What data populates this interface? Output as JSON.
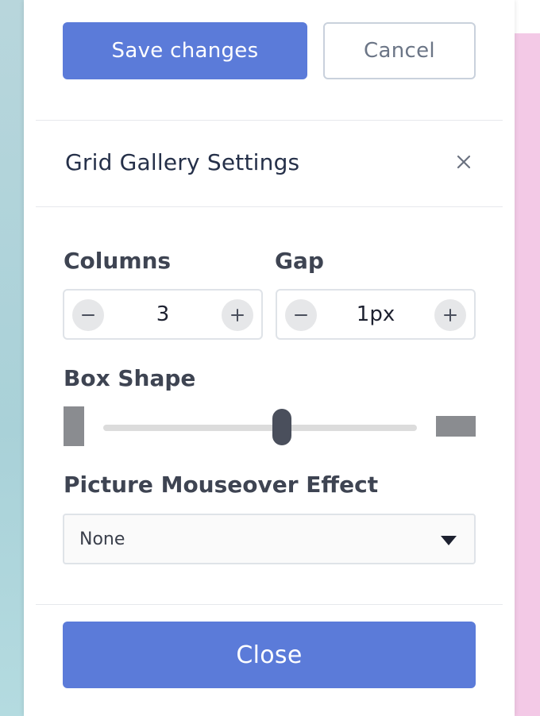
{
  "actions": {
    "save_label": "Save changes",
    "cancel_label": "Cancel"
  },
  "dialog": {
    "title": "Grid Gallery Settings",
    "close_icon": "close-icon"
  },
  "columns": {
    "label": "Columns",
    "value": "3"
  },
  "gap": {
    "label": "Gap",
    "value": "1px"
  },
  "box_shape": {
    "label": "Box Shape",
    "level": 0.57
  },
  "mouseover": {
    "label": "Picture Mouseover Effect",
    "selected": "None"
  },
  "footer": {
    "close_label": "Close"
  },
  "colors": {
    "accent": "#5b7bd9",
    "slider_thumb": "#4a4f5c",
    "shape_icon": "#8a8c90"
  }
}
